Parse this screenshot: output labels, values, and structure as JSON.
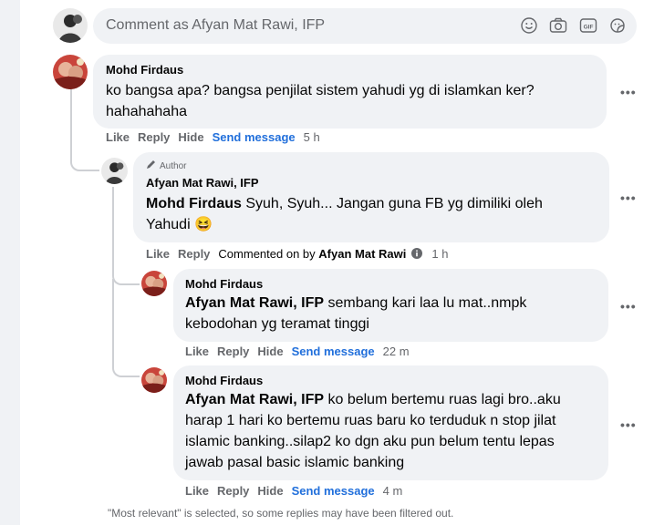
{
  "composer": {
    "placeholder": "Comment as Afyan Mat Rawi, IFP",
    "icons": [
      "emoji-icon",
      "camera-icon",
      "gif-icon",
      "sticker-icon"
    ]
  },
  "comment": {
    "author": "Mohd Firdaus",
    "text_line1": "ko bangsa apa? bangsa penjilat sistem yahudi yg di islamkan ker?",
    "text_line2": "hahahahaha",
    "actions": {
      "like": "Like",
      "reply": "Reply",
      "hide": "Hide",
      "send": "Send message",
      "time": "5 h"
    }
  },
  "reply1": {
    "badge": "Author",
    "author": "Afyan Mat Rawi, IFP",
    "mention": "Mohd Firdaus",
    "text_line1": "Syuh, Syuh... Jangan guna FB yg dimiliki oleh",
    "text_line2": "Yahudi 😆",
    "actions": {
      "like": "Like",
      "reply": "Reply",
      "commented_prefix": "Commented on by",
      "commented_by": "Afyan Mat Rawi",
      "time": "1 h"
    }
  },
  "reply2": {
    "author": "Mohd Firdaus",
    "mention": "Afyan Mat Rawi, IFP",
    "text_line1": "sembang kari laa lu mat..nmpk",
    "text_line2": "kebodohan yg teramat tinggi",
    "actions": {
      "like": "Like",
      "reply": "Reply",
      "hide": "Hide",
      "send": "Send message",
      "time": "22 m"
    }
  },
  "reply3": {
    "author": "Mohd Firdaus",
    "mention": "Afyan Mat Rawi, IFP",
    "text_line1": "ko belum bertemu ruas lagi bro..aku",
    "text_line2": "harap 1 hari ko bertemu ruas baru ko terduduk n stop jilat",
    "text_line3": "islamic banking..silap2 ko dgn aku pun belum tentu lepas",
    "text_line4": "jawab pasal basic islamic banking",
    "actions": {
      "like": "Like",
      "reply": "Reply",
      "hide": "Hide",
      "send": "Send message",
      "time": "4 m"
    }
  },
  "more_label": "•••",
  "footer": "\"Most relevant\" is selected, so some replies may have been filtered out."
}
